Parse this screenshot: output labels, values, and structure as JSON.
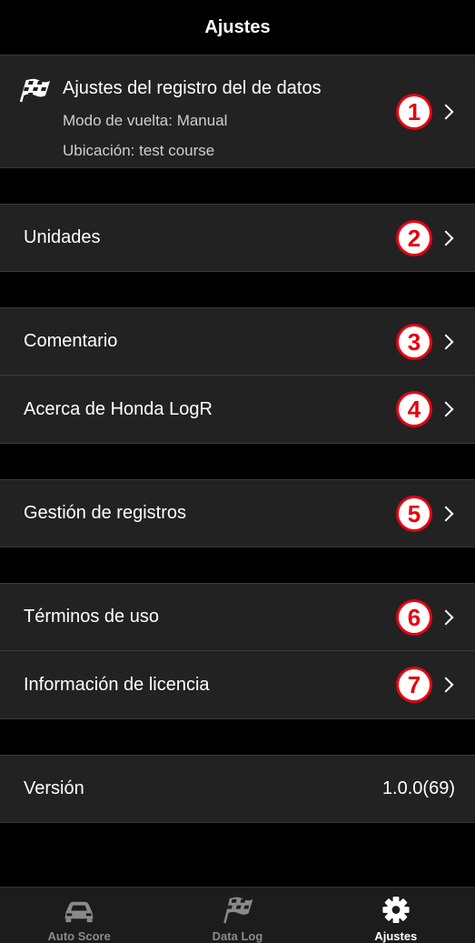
{
  "header": {
    "title": "Ajustes"
  },
  "log_settings": {
    "title": "Ajustes del registro del de datos",
    "lap_mode": "Modo de vuelta: Manual",
    "location": "Ubicación: test course",
    "badge": "1"
  },
  "items": [
    {
      "label": "Unidades",
      "badge": "2"
    },
    {
      "label": "Comentario",
      "badge": "3"
    },
    {
      "label": "Acerca de Honda LogR",
      "badge": "4"
    },
    {
      "label": "Gestión de registros",
      "badge": "5"
    },
    {
      "label": "Términos de uso",
      "badge": "6"
    },
    {
      "label": "Información de licencia",
      "badge": "7"
    }
  ],
  "version": {
    "label": "Versión",
    "value": "1.0.0(69)"
  },
  "tabbar": {
    "tabs": [
      {
        "label": "Auto Score",
        "icon": "car-icon",
        "active": false
      },
      {
        "label": "Data Log",
        "icon": "checkered-flag-icon",
        "active": false
      },
      {
        "label": "Ajustes",
        "icon": "gear-icon",
        "active": true
      }
    ]
  },
  "colors": {
    "accent_badge": "#e60012",
    "row_bg": "#222222",
    "bg": "#000000"
  }
}
